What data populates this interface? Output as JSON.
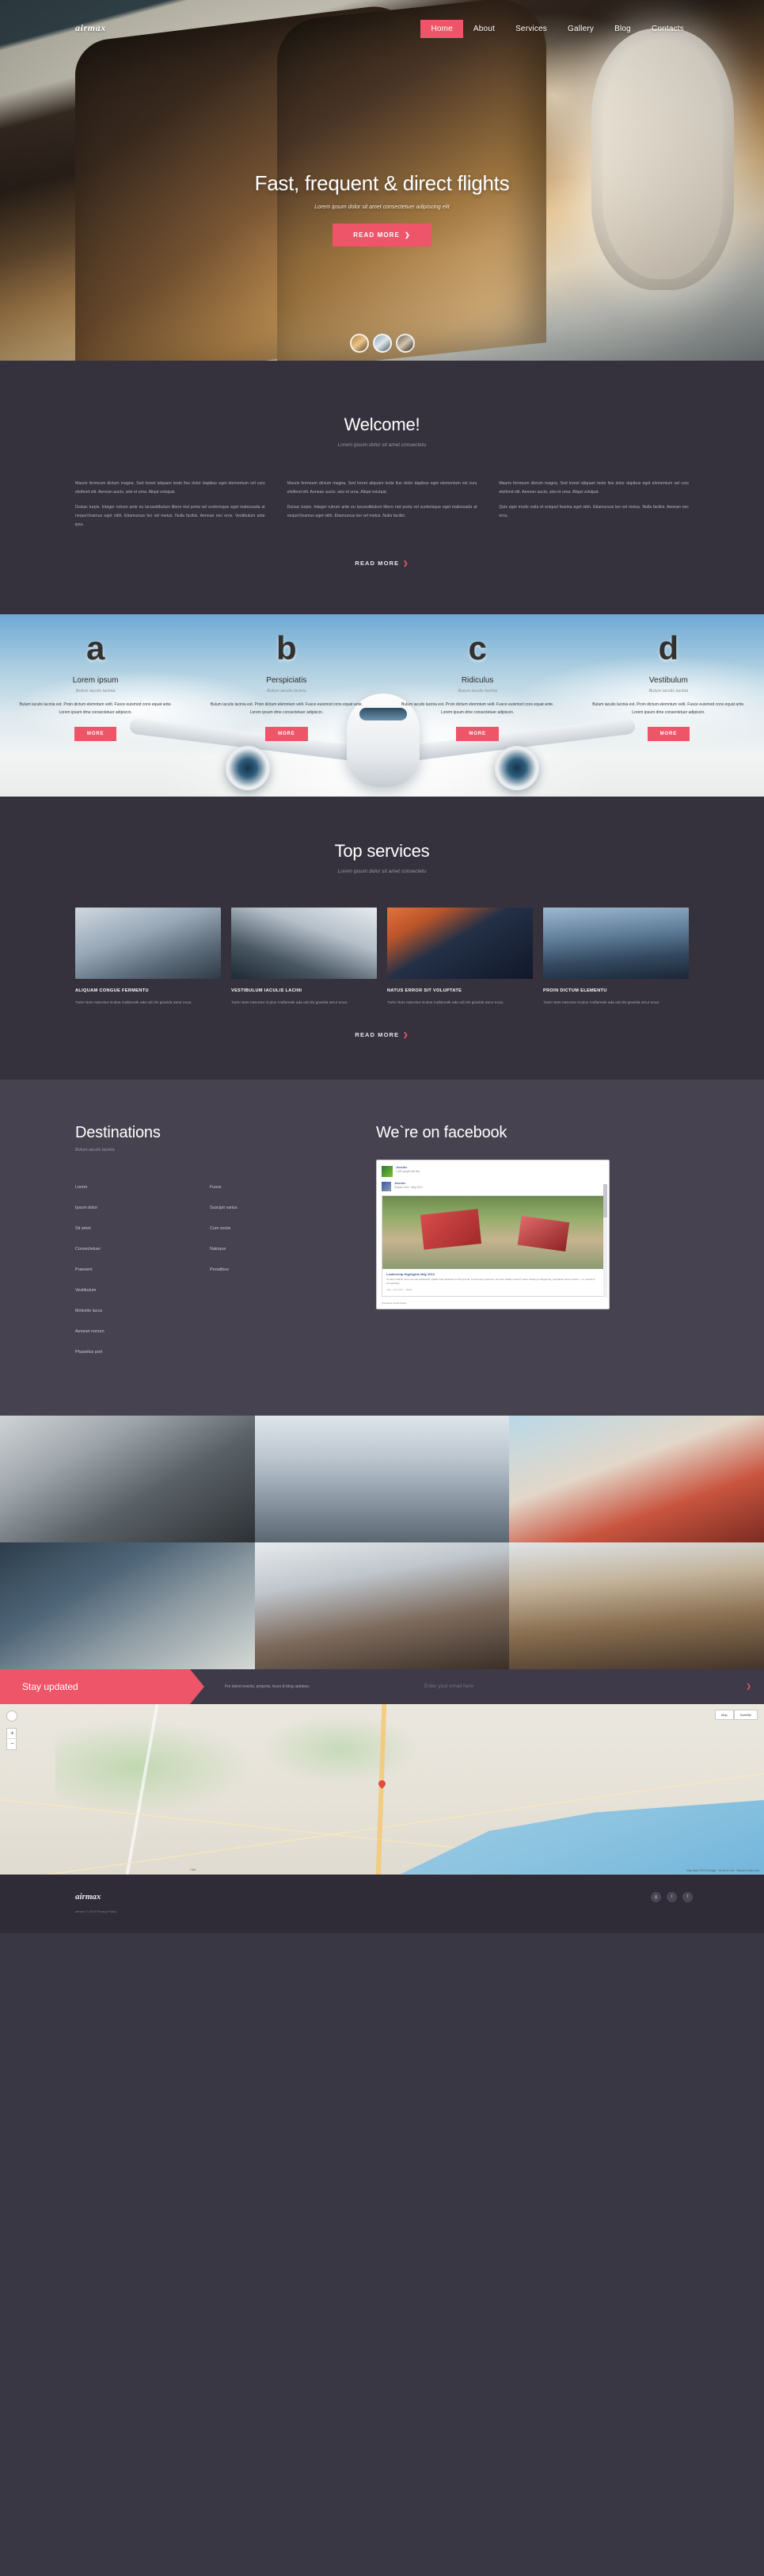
{
  "site": {
    "logo": "airmax"
  },
  "nav": {
    "items": [
      {
        "label": "Home",
        "active": true
      },
      {
        "label": "About",
        "active": false
      },
      {
        "label": "Services",
        "active": false
      },
      {
        "label": "Gallery",
        "active": false
      },
      {
        "label": "Blog",
        "active": false
      },
      {
        "label": "Contacts",
        "active": false
      }
    ]
  },
  "hero": {
    "title": "Fast, frequent & direct flights",
    "subtitle": "Lorem ipsum dolor sit amet consectetuer adipiscing elit",
    "button": "READ MORE",
    "chevron": "❯"
  },
  "welcome": {
    "title": "Welcome!",
    "subtitle": "Lorem ipsum dolor sit amet consectetu",
    "columns": [
      {
        "p1": "Mauris fermeum dictum magna. Sed loreet aliquam leote llus dolor dapibus eget elementum vel curs eleifend elit. Aenean aucto, wisi et urna. Aliqat volutpat.",
        "p2": "Duisac turpis. Integer rutrum ante eu lacuestibulum libero nisl porta vel scelerisque eget malesuada at nequeVivamus eget nibh. Etiamursus leo vel metus. Nulla facilisi. Aenean nec eros. Vestibulum ante ipsu."
      },
      {
        "p1": "Mauris fermeum dictum magna. Sed loreet aliquam leote llus dolor dapibus eget elementum vel curs eleifend elit. Aenean aucto, wisi et urna. Aliqat volutpat.",
        "p2": "Duisac turpis. Integer rutrum ante eu lacuestibulum libero nisl porta vel scelerisque eget malesuada at nequeVivamus eget nibh. Etiamursus leo vel metus. Nulla facilisi."
      },
      {
        "p1": "Mauris fermeum dictum magna. Sed loreet aliquam leote llus dolor dapibus eget elementum vel curs eleifend elit. Aenean aucto, wisi et urna. Aliqat volutpat.",
        "p2": "Quis eget modo nulla et eniquel fearina eget nibh. Etiamursus leo vel metus. Nulla facilisi. Aenean nec eros."
      }
    ],
    "more": "READ MORE",
    "chevron": "❯"
  },
  "features": {
    "items": [
      {
        "letter": "a",
        "title": "Lorem ipsum",
        "subtitle": "Bulum iaculis lacinia",
        "text": "Bulum iaculis lacinia est. Proin dictum elemntum velit. Fusce euismod cons equat ante. Lorem ipsum dme consectetuer adipiscin.",
        "button": "MORE"
      },
      {
        "letter": "b",
        "title": "Perspiciatis",
        "subtitle": "Bulum iaculis lacinia",
        "text": "Bulum iaculis lacinia est. Proin dictum elemntum velit. Fusce euismod cons equat ante. Lorem ipsum dme consectetuer adipiscin.",
        "button": "MORE"
      },
      {
        "letter": "c",
        "title": "Ridiculus",
        "subtitle": "Bulum iaculis lacinia",
        "text": "Bulum iaculis lacinia est. Proin dictum elemntum velit. Fusce euismod cons equat ante. Lorem ipsum dme consectetuer adipiscin.",
        "button": "MORE"
      },
      {
        "letter": "d",
        "title": "Vestibulum",
        "subtitle": "Bulum iaculis lacinia",
        "text": "Bulum iaculis lacinia est. Proin dictum elemntum velit. Fusce euismod cons equat ante. Lorem ipsum dme consectetuer adipiscin.",
        "button": "MORE"
      }
    ]
  },
  "services": {
    "title": "Top services",
    "subtitle": "Lorem ipsum dolor sit amet consectetu",
    "items": [
      {
        "title": "ALIQUAM CONGUE FERMENTU",
        "text": "Turie ntots nascetur riculus mullamale ada odi dio gravida atour ecuu."
      },
      {
        "title": "VESTIBULUM IACULIS LACINI",
        "text": "Turie ntots nascetur riculus mullamale ada odi dio gravida atcur ecuu."
      },
      {
        "title": "NATUS ERROR SIT VOLUPTATE",
        "text": "Turie ntots nascetur riculus mullamale ada odi dio gravida atcur ecuu."
      },
      {
        "title": "PROIN DICTUM ELEMENTU",
        "text": "Turie ntots nascetur riculus mullamale ada odi dio gravida atcur ecuu."
      }
    ],
    "more": "READ MORE",
    "chevron": "❯"
  },
  "destinations": {
    "title": "Destinations",
    "subtitle": "Bulum iaculis lacinia",
    "col1": [
      "Lorem",
      "Ipsum dolor",
      "Sit amet",
      "Consectetuer",
      "Praesent",
      "Vestibulum",
      "Molestie lacus",
      "Aenean nonum",
      "Phasellus port"
    ],
    "col2": [
      "Fusce",
      "Suscipit varius",
      "Cum sociis",
      "Natoque",
      "Penatibus"
    ]
  },
  "facebook": {
    "title": "We`re on facebook",
    "page_name": "Jounder",
    "page_meta": "1,285 people like this",
    "sharer_name": "Jounder",
    "sharer_meta": "Shared a link · May 2013",
    "post_title": "Leadership Highlights May 2013",
    "post_text": "It's been awhile since the last leadership update was published in this journal. Community response: the best reliably doesn't mean nothing is happening, population since a 2012 — in nobody it immediately.",
    "post_foot": "Like · Comment · Share",
    "bottom": "Facebook social plugin"
  },
  "stay": {
    "label": "Stay updated",
    "note": "For latest events, projects, tours & blog updates.",
    "placeholder": "Enter your email here",
    "chevron": "❯"
  },
  "map": {
    "zoom_in": "+",
    "zoom_out": "−",
    "tabs": [
      "Map",
      "Satellite"
    ],
    "scale": "2 km",
    "credit": "Map data ©2013 Google · Terms of Use · Report a map error"
  },
  "footer": {
    "logo": "airmax",
    "copyright": "airmax © 2013 Privacy Policy",
    "social": [
      {
        "name": "google-plus-icon",
        "glyph": "g"
      },
      {
        "name": "twitter-icon",
        "glyph": "t"
      },
      {
        "name": "facebook-icon",
        "glyph": "f"
      }
    ]
  }
}
